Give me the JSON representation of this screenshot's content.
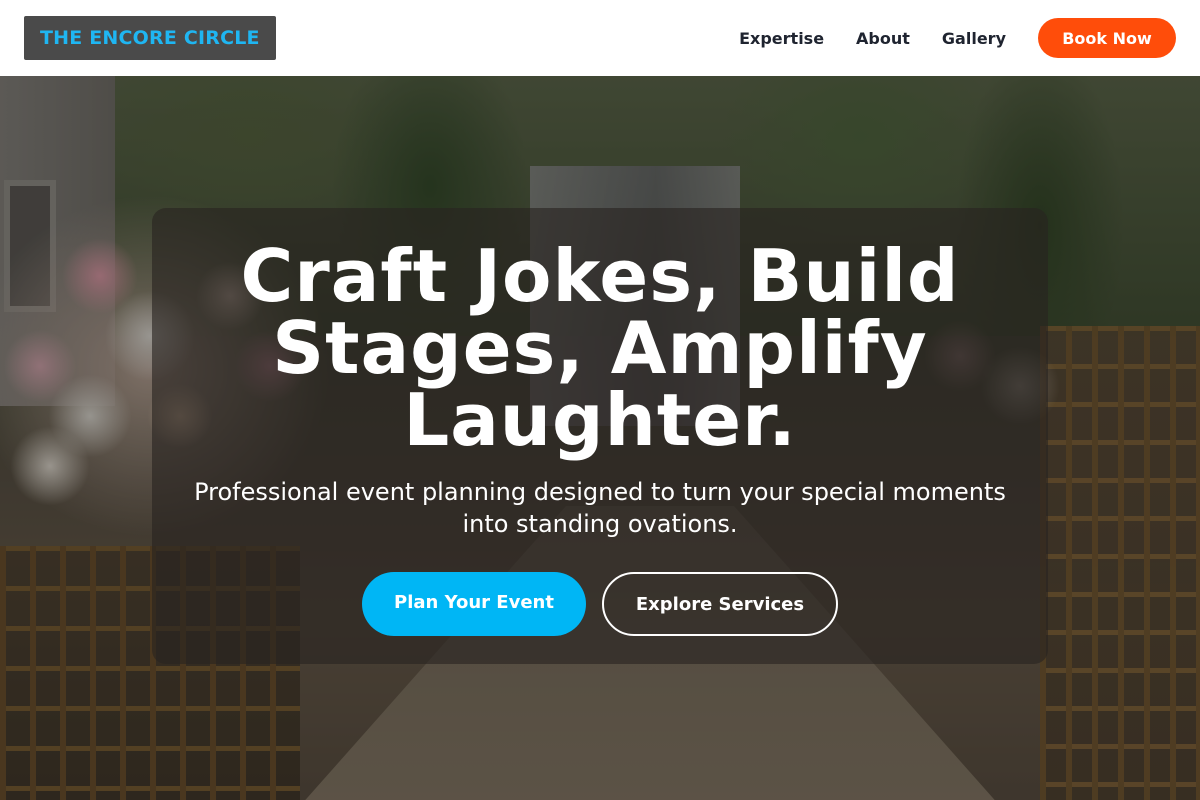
{
  "header": {
    "logo_text": "THE ENCORE CIRCLE",
    "nav": [
      {
        "label": "Expertise"
      },
      {
        "label": "About"
      },
      {
        "label": "Gallery"
      }
    ],
    "cta_label": "Book Now"
  },
  "hero": {
    "headline": "Craft Jokes, Build Stages, Amplify Laughter.",
    "subtext": "Professional event planning designed to turn your special moments into standing ovations.",
    "primary_button": "Plan Your Event",
    "secondary_button": "Explore Services",
    "background_image": "outdoor wedding aisle with flowers and chairs"
  },
  "colors": {
    "logo_text": "#1fb6f2",
    "logo_bg": "#4a4a4a",
    "book_button": "#ff4d0a",
    "primary_button": "#00b6f5",
    "nav_text": "#1f2430"
  }
}
